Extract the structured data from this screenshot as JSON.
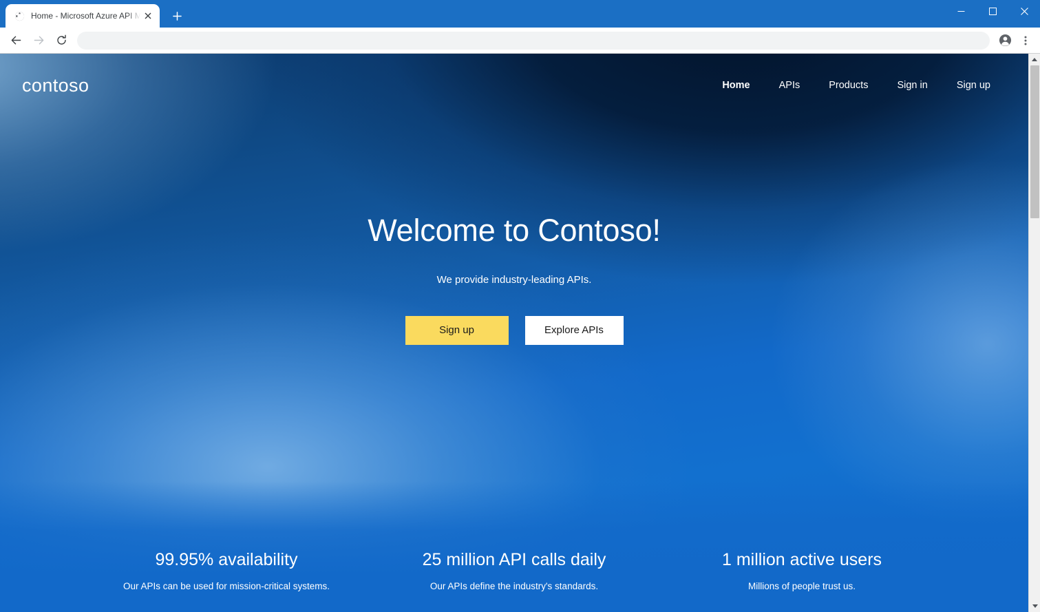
{
  "browser": {
    "tab": {
      "title": "Home - Microsoft Azure API Man",
      "favicon": "globe-icon",
      "close": "×"
    },
    "new_tab_label": "+",
    "window_controls": {
      "minimize": "—",
      "maximize": "☐",
      "close": "✕"
    },
    "toolbar": {
      "back": "back-arrow-icon",
      "forward": "forward-arrow-icon",
      "reload": "reload-icon",
      "address_value": "",
      "address_placeholder": "",
      "profile": "profile-avatar-icon",
      "menu": "three-dot-menu-icon"
    }
  },
  "site": {
    "brand": "contoso",
    "nav": [
      {
        "label": "Home",
        "active": true
      },
      {
        "label": "APIs",
        "active": false
      },
      {
        "label": "Products",
        "active": false
      },
      {
        "label": "Sign in",
        "active": false
      },
      {
        "label": "Sign up",
        "active": false
      }
    ],
    "hero": {
      "title": "Welcome to Contoso!",
      "subtitle": "We provide industry-leading APIs.",
      "primary_cta": "Sign up",
      "secondary_cta": "Explore APIs"
    },
    "stats": [
      {
        "value": "99.95% availability",
        "description": "Our APIs can be used for mission-critical systems."
      },
      {
        "value": "25 million API calls daily",
        "description": "Our APIs define the industry's standards."
      },
      {
        "value": "1 million active users",
        "description": "Millions of people trust us."
      }
    ]
  },
  "colors": {
    "chrome_blue": "#1b6fc4",
    "hero_navy": "#041830",
    "page_blue": "#1269c9",
    "cta_yellow": "#fada5e",
    "white": "#ffffff"
  }
}
